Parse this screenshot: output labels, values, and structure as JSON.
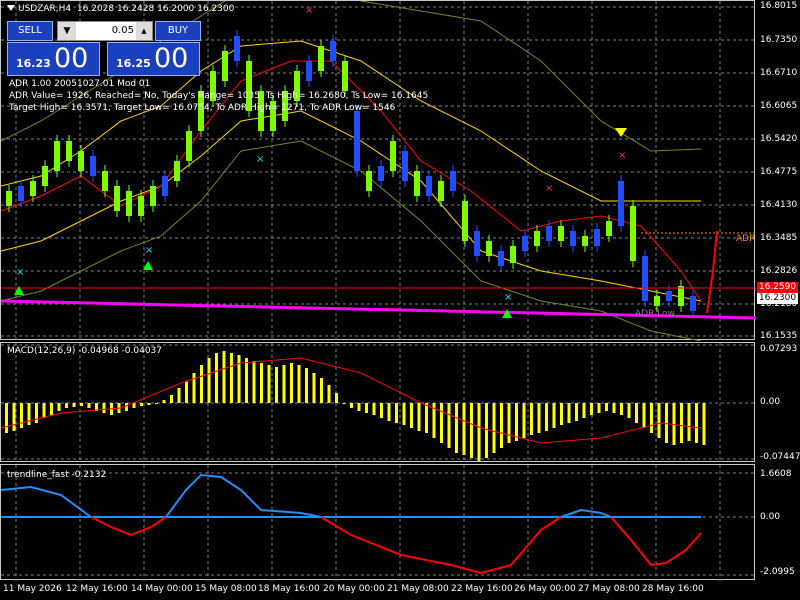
{
  "chart": {
    "symbol_label": "USDZAR,H4",
    "ohlc": "16.2028 16.2428 16.2000 16.2300"
  },
  "trade_panel": {
    "sell_label": "SELL",
    "buy_label": "BUY",
    "lot_value": "0.05",
    "dec_icon": "triangle-down",
    "inc_icon": "triangle-up",
    "sell_small": "16.23",
    "sell_big": "00",
    "buy_small": "16.25",
    "buy_big": "00"
  },
  "adr_info": {
    "line1": "ADR 1.00 20051027.01 Mod 01",
    "line2": "ADR Value= 1926, Reached= No, Today's Range= 1035, Ts High= 16.2680, Ts Low= 16.1645",
    "line3": "Target High= 16.3571, Target Low= 16.0754, To ADR High= 1271, To ADR Low= 1546"
  },
  "price_axis": [
    "16.8015",
    "16.7350",
    "16.6710",
    "16.6065",
    "16.5420",
    "16.4775",
    "16.4130",
    "16.3485",
    "16.2826",
    "16.2180",
    "16.1535"
  ],
  "price_tags": {
    "red_tag": "16.2590",
    "white_tag": "16.2300",
    "adr_label": "ADR",
    "adr_low_label": "ADR Low"
  },
  "macd": {
    "title": "MACD(12,26,9) -0.04968 -0.04037",
    "axis": [
      "0.07293",
      "0.00",
      "-0.07447"
    ],
    "colors": {
      "histogram": "#ffff00",
      "signal": "#ff0000"
    }
  },
  "trendline": {
    "title": "trendline_fast -0.2132",
    "axis": [
      "1.6608",
      "0.00",
      "-2.0995"
    ],
    "colors": {
      "positive": "#1e90ff",
      "negative": "#ff0000"
    }
  },
  "time_axis": [
    "11 May 2026",
    "12 May 16:00",
    "14 May 00:00",
    "15 May 08:00",
    "18 May 16:00",
    "20 May 00:00",
    "21 May 08:00",
    "22 May 16:00",
    "26 May 00:00",
    "27 May 08:00",
    "28 May 16:00"
  ],
  "colors": {
    "bull_candle": "#7CFC00",
    "bear_candle": "#1e50ff",
    "grid": "#808080",
    "magenta_line": "#ff00ff",
    "envelope_outer": "#6b8e23",
    "envelope_mid": "#ffd700",
    "ma_red": "#ff0000"
  }
}
